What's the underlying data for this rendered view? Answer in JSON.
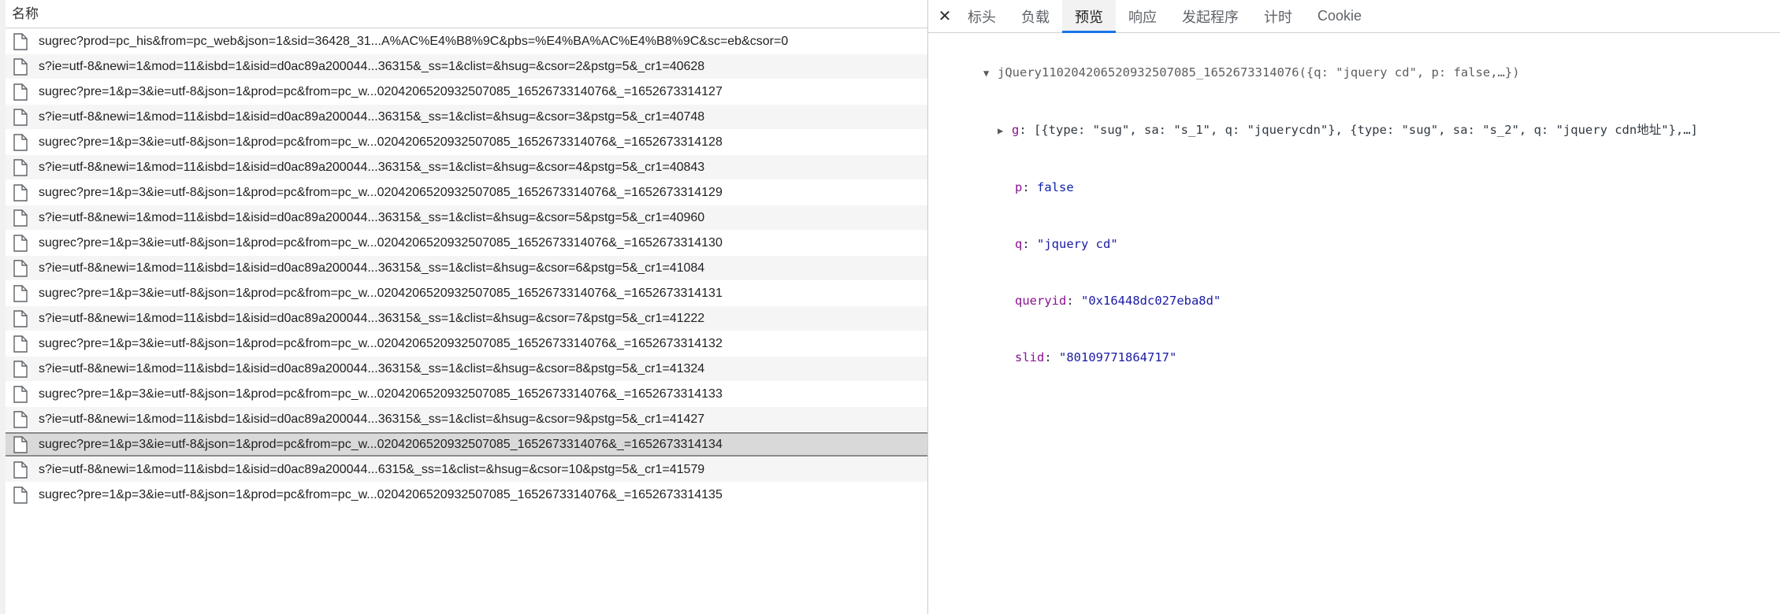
{
  "network": {
    "column_header": "名称",
    "requests": [
      {
        "name": "sugrec?prod=pc_his&from=pc_web&json=1&sid=36428_31...A%AC%E4%B8%9C&pbs=%E4%BA%AC%E4%B8%9C&sc=eb&csor=0",
        "selected": false
      },
      {
        "name": "s?ie=utf-8&newi=1&mod=11&isbd=1&isid=d0ac89a200044...36315&_ss=1&clist=&hsug=&csor=2&pstg=5&_cr1=40628",
        "selected": false
      },
      {
        "name": "sugrec?pre=1&p=3&ie=utf-8&json=1&prod=pc&from=pc_w...0204206520932507085_1652673314076&_=1652673314127",
        "selected": false
      },
      {
        "name": "s?ie=utf-8&newi=1&mod=11&isbd=1&isid=d0ac89a200044...36315&_ss=1&clist=&hsug=&csor=3&pstg=5&_cr1=40748",
        "selected": false
      },
      {
        "name": "sugrec?pre=1&p=3&ie=utf-8&json=1&prod=pc&from=pc_w...0204206520932507085_1652673314076&_=1652673314128",
        "selected": false
      },
      {
        "name": "s?ie=utf-8&newi=1&mod=11&isbd=1&isid=d0ac89a200044...36315&_ss=1&clist=&hsug=&csor=4&pstg=5&_cr1=40843",
        "selected": false
      },
      {
        "name": "sugrec?pre=1&p=3&ie=utf-8&json=1&prod=pc&from=pc_w...0204206520932507085_1652673314076&_=1652673314129",
        "selected": false
      },
      {
        "name": "s?ie=utf-8&newi=1&mod=11&isbd=1&isid=d0ac89a200044...36315&_ss=1&clist=&hsug=&csor=5&pstg=5&_cr1=40960",
        "selected": false
      },
      {
        "name": "sugrec?pre=1&p=3&ie=utf-8&json=1&prod=pc&from=pc_w...0204206520932507085_1652673314076&_=1652673314130",
        "selected": false
      },
      {
        "name": "s?ie=utf-8&newi=1&mod=11&isbd=1&isid=d0ac89a200044...36315&_ss=1&clist=&hsug=&csor=6&pstg=5&_cr1=41084",
        "selected": false
      },
      {
        "name": "sugrec?pre=1&p=3&ie=utf-8&json=1&prod=pc&from=pc_w...0204206520932507085_1652673314076&_=1652673314131",
        "selected": false
      },
      {
        "name": "s?ie=utf-8&newi=1&mod=11&isbd=1&isid=d0ac89a200044...36315&_ss=1&clist=&hsug=&csor=7&pstg=5&_cr1=41222",
        "selected": false
      },
      {
        "name": "sugrec?pre=1&p=3&ie=utf-8&json=1&prod=pc&from=pc_w...0204206520932507085_1652673314076&_=1652673314132",
        "selected": false
      },
      {
        "name": "s?ie=utf-8&newi=1&mod=11&isbd=1&isid=d0ac89a200044...36315&_ss=1&clist=&hsug=&csor=8&pstg=5&_cr1=41324",
        "selected": false
      },
      {
        "name": "sugrec?pre=1&p=3&ie=utf-8&json=1&prod=pc&from=pc_w...0204206520932507085_1652673314076&_=1652673314133",
        "selected": false
      },
      {
        "name": "s?ie=utf-8&newi=1&mod=11&isbd=1&isid=d0ac89a200044...36315&_ss=1&clist=&hsug=&csor=9&pstg=5&_cr1=41427",
        "selected": false
      },
      {
        "name": "sugrec?pre=1&p=3&ie=utf-8&json=1&prod=pc&from=pc_w...0204206520932507085_1652673314076&_=1652673314134",
        "selected": true
      },
      {
        "name": "s?ie=utf-8&newi=1&mod=11&isbd=1&isid=d0ac89a200044...6315&_ss=1&clist=&hsug=&csor=10&pstg=5&_cr1=41579",
        "selected": false
      },
      {
        "name": "sugrec?pre=1&p=3&ie=utf-8&json=1&prod=pc&from=pc_w...0204206520932507085_1652673314076&_=1652673314135",
        "selected": false
      }
    ]
  },
  "details": {
    "close_icon": "close-icon",
    "tabs": [
      {
        "label": "标头",
        "active": false
      },
      {
        "label": "负载",
        "active": false
      },
      {
        "label": "预览",
        "active": true
      },
      {
        "label": "响应",
        "active": false
      },
      {
        "label": "发起程序",
        "active": false
      },
      {
        "label": "计时",
        "active": false
      },
      {
        "label": "Cookie",
        "active": false
      }
    ],
    "preview": {
      "root_line": "jQuery110204206520932507085_1652673314076({q: \"jquery cd\", p: false,…})",
      "g_key": "g",
      "g_value": "[{type: \"sug\", sa: \"s_1\", q: \"jquerycdn\"}, {type: \"sug\", sa: \"s_2\", q: \"jquery cdn地址\"},…]",
      "p_key": "p",
      "p_value": "false",
      "q_key": "q",
      "q_value": "\"jquery cd\"",
      "queryid_key": "queryid",
      "queryid_value": "\"0x16448dc027eba8d\"",
      "slid_key": "slid",
      "slid_value": "\"80109771864717\""
    }
  },
  "colors": {
    "accent": "#1a73e8",
    "selected_row": "#d9d9d9",
    "key": "#881391",
    "string_value": "#1a1aa6"
  }
}
